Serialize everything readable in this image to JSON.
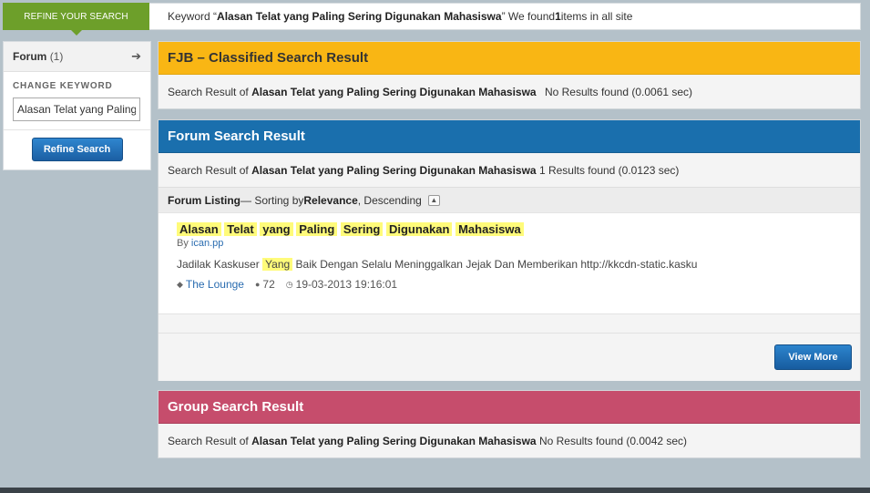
{
  "top": {
    "refine_tab": "REFINE YOUR SEARCH",
    "keyword_prefix": "Keyword “",
    "keyword": "Alasan Telat yang Paling Sering Digunakan Mahasiswa",
    "keyword_suffix": "” We found ",
    "count": "1",
    "count_suffix": " items in all site"
  },
  "sidebar": {
    "forum_label": "Forum",
    "forum_count": "(1)",
    "change_keyword": "CHANGE KEYWORD",
    "input_value": "Alasan Telat yang Paling Sering Digunakan Mahasiswa",
    "refine_button": "Refine Search"
  },
  "fjb": {
    "title": "FJB – Classified Search Result",
    "prefix": "Search Result of ",
    "keyword": "Alasan Telat yang Paling Sering Digunakan Mahasiswa",
    "result": "No Results found (0.0061 sec)"
  },
  "forum": {
    "title": "Forum Search Result",
    "prefix": "Search Result of ",
    "keyword": "Alasan Telat yang Paling Sering Digunakan Mahasiswa",
    "result": "1 Results found (0.0123 sec)",
    "listing": {
      "label": "Forum Listing",
      "sort_prefix": " — Sorting by ",
      "sort_field": "Relevance",
      "sort_order": ", Descending"
    },
    "items": [
      {
        "title_words": [
          "Alasan",
          "Telat",
          "yang",
          "Paling",
          "Sering",
          "Digunakan",
          "Mahasiswa"
        ],
        "by_label": "By ",
        "author": "ican.pp",
        "snippet_before": "Jadilak Kaskuser ",
        "snippet_highlight": "Yang",
        "snippet_after": " Baik Dengan Selalu Meninggalkan Jejak Dan Memberikan http://kkcdn-static.kasku",
        "category": "The Lounge",
        "replies": "72",
        "date": "19-03-2013 19:16:01"
      }
    ],
    "view_more": "View More"
  },
  "group": {
    "title": "Group Search Result",
    "prefix": "Search Result of ",
    "keyword": "Alasan Telat yang Paling Sering Digunakan Mahasiswa",
    "result": "No Results found (0.0042 sec)"
  },
  "icons": {
    "arrow": "arrow-right-icon",
    "collapse": "collapse-icon",
    "tag": "tag-icon",
    "comment": "comment-icon",
    "clock": "clock-icon"
  },
  "colors": {
    "refine_tab": "#6d9f2a",
    "fjb_header": "#f9b614",
    "forum_header": "#1a6fad",
    "group_header": "#c64d6c",
    "highlight": "#fffb7a"
  }
}
